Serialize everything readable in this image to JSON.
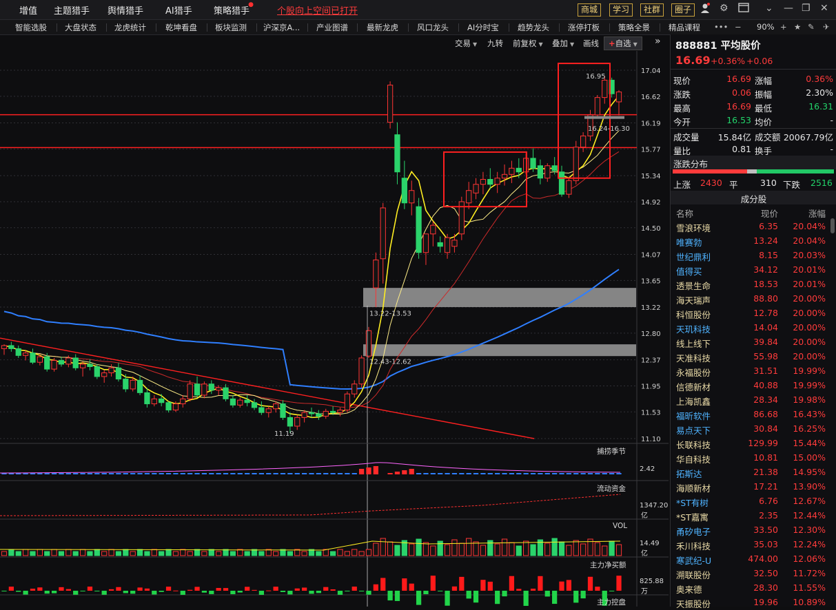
{
  "topmenu": {
    "items": [
      "增值",
      "主题猎手",
      "舆情猎手",
      "AI猎手",
      "策略猎手"
    ],
    "alert_link": "个股向上空间已打开",
    "boxed": [
      "商城",
      "学习",
      "社群",
      "圈子"
    ],
    "colors": {
      "accent_red": "#ff3b3b",
      "accent_gold": "#f3d27a"
    }
  },
  "navbar": {
    "items": [
      "智能选股",
      "大盘状态",
      "龙虎统计",
      "乾坤看盘",
      "板块监测",
      "沪深京A...",
      "产业图谱",
      "最新龙虎",
      "风口龙头",
      "AI分时宝",
      "趋势龙头",
      "涨停打板",
      "策略全景",
      "精品课程"
    ],
    "zoom": "90%"
  },
  "chart_toolbar": {
    "items": [
      "交易",
      "九转",
      "前复权",
      "叠加",
      "画线"
    ],
    "watch_button": "自选"
  },
  "chart_data": {
    "type": "candlestick",
    "price_axis": [
      "17.04",
      "16.62",
      "16.19",
      "15.77",
      "15.34",
      "14.92",
      "14.50",
      "14.07",
      "13.65",
      "13.22",
      "12.80",
      "12.37",
      "11.95",
      "11.53",
      "11.10"
    ],
    "ylim": [
      11.1,
      17.04
    ],
    "annotations": {
      "high": "16.95",
      "low": "11.19",
      "gap_upper": "13.22-13.53",
      "gap_lower": "12.43-12.62",
      "zone_recent": "16.24-16.30"
    },
    "candles": [
      [
        12.55,
        12.62,
        12.45,
        12.6
      ],
      [
        12.6,
        12.66,
        12.5,
        12.55
      ],
      [
        12.55,
        12.6,
        12.4,
        12.44
      ],
      [
        12.44,
        12.52,
        12.36,
        12.48
      ],
      [
        12.48,
        12.55,
        12.3,
        12.33
      ],
      [
        12.33,
        12.46,
        12.28,
        12.42
      ],
      [
        12.42,
        12.48,
        12.18,
        12.22
      ],
      [
        12.22,
        12.4,
        12.18,
        12.36
      ],
      [
        12.36,
        12.42,
        12.26,
        12.3
      ],
      [
        12.3,
        12.44,
        12.25,
        12.4
      ],
      [
        12.4,
        12.46,
        12.2,
        12.24
      ],
      [
        12.24,
        12.34,
        12.1,
        12.3
      ],
      [
        12.3,
        12.38,
        12.2,
        12.26
      ],
      [
        12.26,
        12.3,
        12.06,
        12.1
      ],
      [
        12.1,
        12.2,
        12.0,
        12.16
      ],
      [
        12.16,
        12.3,
        12.1,
        12.24
      ],
      [
        12.24,
        12.32,
        12.02,
        12.06
      ],
      [
        12.06,
        12.14,
        11.85,
        11.9
      ],
      [
        11.9,
        12.1,
        11.86,
        12.04
      ],
      [
        12.04,
        12.12,
        11.8,
        11.84
      ],
      [
        11.84,
        11.92,
        11.6,
        11.66
      ],
      [
        11.66,
        11.8,
        11.62,
        11.74
      ],
      [
        11.74,
        11.82,
        11.62,
        11.68
      ],
      [
        11.68,
        11.7,
        11.52,
        11.56
      ],
      [
        11.56,
        11.7,
        11.53,
        11.66
      ],
      [
        11.66,
        11.8,
        11.6,
        11.74
      ],
      [
        11.74,
        12.04,
        11.7,
        11.98
      ],
      [
        11.98,
        12.1,
        11.76,
        11.8
      ],
      [
        11.8,
        12.02,
        11.75,
        11.98
      ],
      [
        11.98,
        12.04,
        11.82,
        11.88
      ],
      [
        11.88,
        11.96,
        11.8,
        11.92
      ],
      [
        11.92,
        11.98,
        11.7,
        11.74
      ],
      [
        11.74,
        11.8,
        11.6,
        11.64
      ],
      [
        11.64,
        11.76,
        11.6,
        11.72
      ],
      [
        11.72,
        11.8,
        11.62,
        11.68
      ],
      [
        11.68,
        11.74,
        11.56,
        11.6
      ],
      [
        11.6,
        11.7,
        11.48,
        11.52
      ],
      [
        11.52,
        11.62,
        11.44,
        11.58
      ],
      [
        11.58,
        11.7,
        11.52,
        11.66
      ],
      [
        11.66,
        11.72,
        11.4,
        11.44
      ],
      [
        11.44,
        11.52,
        11.19,
        11.3
      ],
      [
        11.3,
        11.48,
        11.24,
        11.44
      ],
      [
        11.44,
        11.56,
        11.36,
        11.52
      ],
      [
        11.52,
        11.6,
        11.44,
        11.5
      ],
      [
        11.5,
        11.56,
        11.4,
        11.46
      ],
      [
        11.46,
        11.58,
        11.42,
        11.54
      ],
      [
        11.54,
        11.62,
        11.48,
        11.52
      ],
      [
        11.52,
        11.6,
        11.46,
        11.56
      ],
      [
        11.56,
        11.86,
        11.52,
        11.82
      ],
      [
        11.82,
        12.04,
        11.76,
        11.98
      ],
      [
        11.98,
        12.44,
        11.92,
        12.4
      ],
      [
        12.43,
        12.9,
        12.4,
        12.84
      ],
      [
        13.53,
        14.1,
        13.22,
        13.98
      ],
      [
        14.0,
        14.9,
        13.6,
        14.82
      ],
      [
        16.2,
        16.86,
        16.1,
        16.8
      ],
      [
        16.0,
        16.2,
        15.2,
        15.4
      ],
      [
        15.3,
        15.58,
        14.8,
        14.9
      ],
      [
        14.9,
        15.26,
        14.7,
        15.1
      ],
      [
        14.84,
        14.98,
        14.0,
        14.1
      ],
      [
        14.1,
        14.3,
        13.9,
        14.4
      ],
      [
        14.4,
        14.6,
        14.2,
        14.54
      ],
      [
        14.26,
        14.36,
        14.1,
        14.2
      ],
      [
        14.1,
        14.4,
        14.0,
        14.34
      ],
      [
        14.2,
        14.4,
        14.1,
        14.3
      ],
      [
        14.4,
        15.0,
        14.3,
        14.92
      ],
      [
        14.9,
        15.24,
        14.8,
        15.1
      ],
      [
        15.06,
        15.3,
        14.96,
        15.2
      ],
      [
        15.2,
        15.4,
        15.04,
        15.28
      ],
      [
        15.28,
        15.46,
        15.12,
        15.2
      ],
      [
        15.2,
        15.4,
        15.06,
        15.3
      ],
      [
        15.3,
        15.52,
        15.18,
        15.36
      ],
      [
        15.36,
        15.58,
        15.22,
        15.46
      ],
      [
        15.46,
        15.62,
        15.3,
        15.4
      ],
      [
        15.4,
        15.7,
        15.36,
        15.62
      ],
      [
        15.62,
        15.78,
        15.4,
        15.46
      ],
      [
        15.5,
        15.6,
        15.2,
        15.3
      ],
      [
        15.3,
        15.54,
        15.24,
        15.5
      ],
      [
        15.5,
        15.64,
        15.36,
        15.42
      ],
      [
        15.4,
        15.5,
        15.0,
        15.04
      ],
      [
        15.04,
        15.3,
        14.98,
        15.26
      ],
      [
        15.26,
        15.9,
        15.2,
        15.8
      ],
      [
        15.8,
        16.04,
        15.72,
        15.98
      ],
      [
        15.98,
        16.4,
        15.9,
        16.32
      ],
      [
        16.32,
        16.64,
        16.28,
        16.6
      ],
      [
        16.6,
        16.95,
        16.5,
        16.88
      ],
      [
        16.88,
        16.92,
        16.6,
        16.66
      ],
      [
        16.53,
        16.72,
        16.31,
        16.69
      ]
    ],
    "indicators": {
      "capture_label": "捕捞季节",
      "capture_value": "2.42",
      "flow_label": "流动资金",
      "flow_value": "1347.20",
      "flow_unit": "亿",
      "vol_label": "VOL",
      "vol_value": "14.49",
      "vol_unit": "亿",
      "net_label": "主力净买额",
      "net_value": "825.88",
      "net_unit": "万",
      "control_label": "主力控盘"
    }
  },
  "quote": {
    "code_name": "888881 平均股价",
    "price": "16.69",
    "change_pct": "+0.36%",
    "change": "+0.06",
    "fields": [
      {
        "k1": "现价",
        "v1": "16.69",
        "c1": "red",
        "k2": "涨幅",
        "v2": "0.36%",
        "c2": "red"
      },
      {
        "k1": "涨跌",
        "v1": "0.06",
        "c1": "red",
        "k2": "振幅",
        "v2": "2.30%",
        "c2": "white"
      },
      {
        "k1": "最高",
        "v1": "16.69",
        "c1": "red",
        "k2": "最低",
        "v2": "16.31",
        "c2": "green"
      },
      {
        "k1": "今开",
        "v1": "16.53",
        "c1": "green",
        "k2": "均价",
        "v2": "-",
        "c2": "white"
      }
    ],
    "fields2": [
      {
        "k1": "成交量",
        "v1": "15.84亿",
        "k2": "成交额",
        "v2": "20067.79亿"
      },
      {
        "k1": "量比",
        "v1": "0.81",
        "k2": "换手",
        "v2": "-"
      }
    ]
  },
  "distribution": {
    "title": "涨跌分布",
    "up_label": "上涨",
    "up": "2430",
    "flat_label": "平",
    "flat": "310",
    "down_label": "下跌",
    "down": "2516",
    "up_value": 2430,
    "flat_value": 310,
    "down_value": 2516
  },
  "constituents": {
    "title": "成分股",
    "headers": [
      "名称",
      "现价",
      "涨幅"
    ],
    "rows": [
      {
        "name": "雪浪环境",
        "price": "6.35",
        "pct": "20.04%",
        "nc": "#e8d9a6"
      },
      {
        "name": "唯赛勃",
        "price": "13.24",
        "pct": "20.04%",
        "nc": "#4fb3ff"
      },
      {
        "name": "世纪鼎利",
        "price": "8.15",
        "pct": "20.03%",
        "nc": "#4fb3ff"
      },
      {
        "name": "值得买",
        "price": "34.12",
        "pct": "20.01%",
        "nc": "#4fb3ff"
      },
      {
        "name": "透景生命",
        "price": "18.53",
        "pct": "20.01%",
        "nc": "#e8d9a6"
      },
      {
        "name": "海天瑞声",
        "price": "88.80",
        "pct": "20.00%",
        "nc": "#e8d9a6"
      },
      {
        "name": "科恒股份",
        "price": "12.78",
        "pct": "20.00%",
        "nc": "#e8d9a6"
      },
      {
        "name": "天玑科技",
        "price": "14.04",
        "pct": "20.00%",
        "nc": "#4fb3ff"
      },
      {
        "name": "线上线下",
        "price": "39.84",
        "pct": "20.00%",
        "nc": "#e8d9a6"
      },
      {
        "name": "天准科技",
        "price": "55.98",
        "pct": "20.00%",
        "nc": "#e8d9a6"
      },
      {
        "name": "永福股份",
        "price": "31.51",
        "pct": "19.99%",
        "nc": "#e8d9a6"
      },
      {
        "name": "信德新材",
        "price": "40.88",
        "pct": "19.99%",
        "nc": "#e8d9a6"
      },
      {
        "name": "上海凯鑫",
        "price": "28.34",
        "pct": "19.98%",
        "nc": "#e8d9a6"
      },
      {
        "name": "福昕软件",
        "price": "86.68",
        "pct": "16.43%",
        "nc": "#4fb3ff"
      },
      {
        "name": "易点天下",
        "price": "30.84",
        "pct": "16.25%",
        "nc": "#4fb3ff"
      },
      {
        "name": "长联科技",
        "price": "129.99",
        "pct": "15.44%",
        "nc": "#e8d9a6"
      },
      {
        "name": "华自科技",
        "price": "10.81",
        "pct": "15.00%",
        "nc": "#e8d9a6"
      },
      {
        "name": "拓斯达",
        "price": "21.38",
        "pct": "14.95%",
        "nc": "#4fb3ff"
      },
      {
        "name": "海顺新材",
        "price": "17.21",
        "pct": "13.90%",
        "nc": "#e8d9a6"
      },
      {
        "name": "*ST有树",
        "price": "6.76",
        "pct": "12.67%",
        "nc": "#4fb3ff"
      },
      {
        "name": "*ST嘉寓",
        "price": "2.35",
        "pct": "12.44%",
        "nc": "#e8d9a6"
      },
      {
        "name": "甬矽电子",
        "price": "33.50",
        "pct": "12.30%",
        "nc": "#4fb3ff"
      },
      {
        "name": "禾川科技",
        "price": "35.03",
        "pct": "12.24%",
        "nc": "#e8d9a6"
      },
      {
        "name": "寒武纪-U",
        "price": "474.00",
        "pct": "12.06%",
        "nc": "#4fb3ff"
      },
      {
        "name": "溯联股份",
        "price": "32.50",
        "pct": "11.72%",
        "nc": "#e8d9a6"
      },
      {
        "name": "奥来德",
        "price": "28.30",
        "pct": "11.55%",
        "nc": "#e8d9a6"
      },
      {
        "name": "天振股份",
        "price": "19.96",
        "pct": "10.89%",
        "nc": "#e8d9a6"
      }
    ]
  }
}
